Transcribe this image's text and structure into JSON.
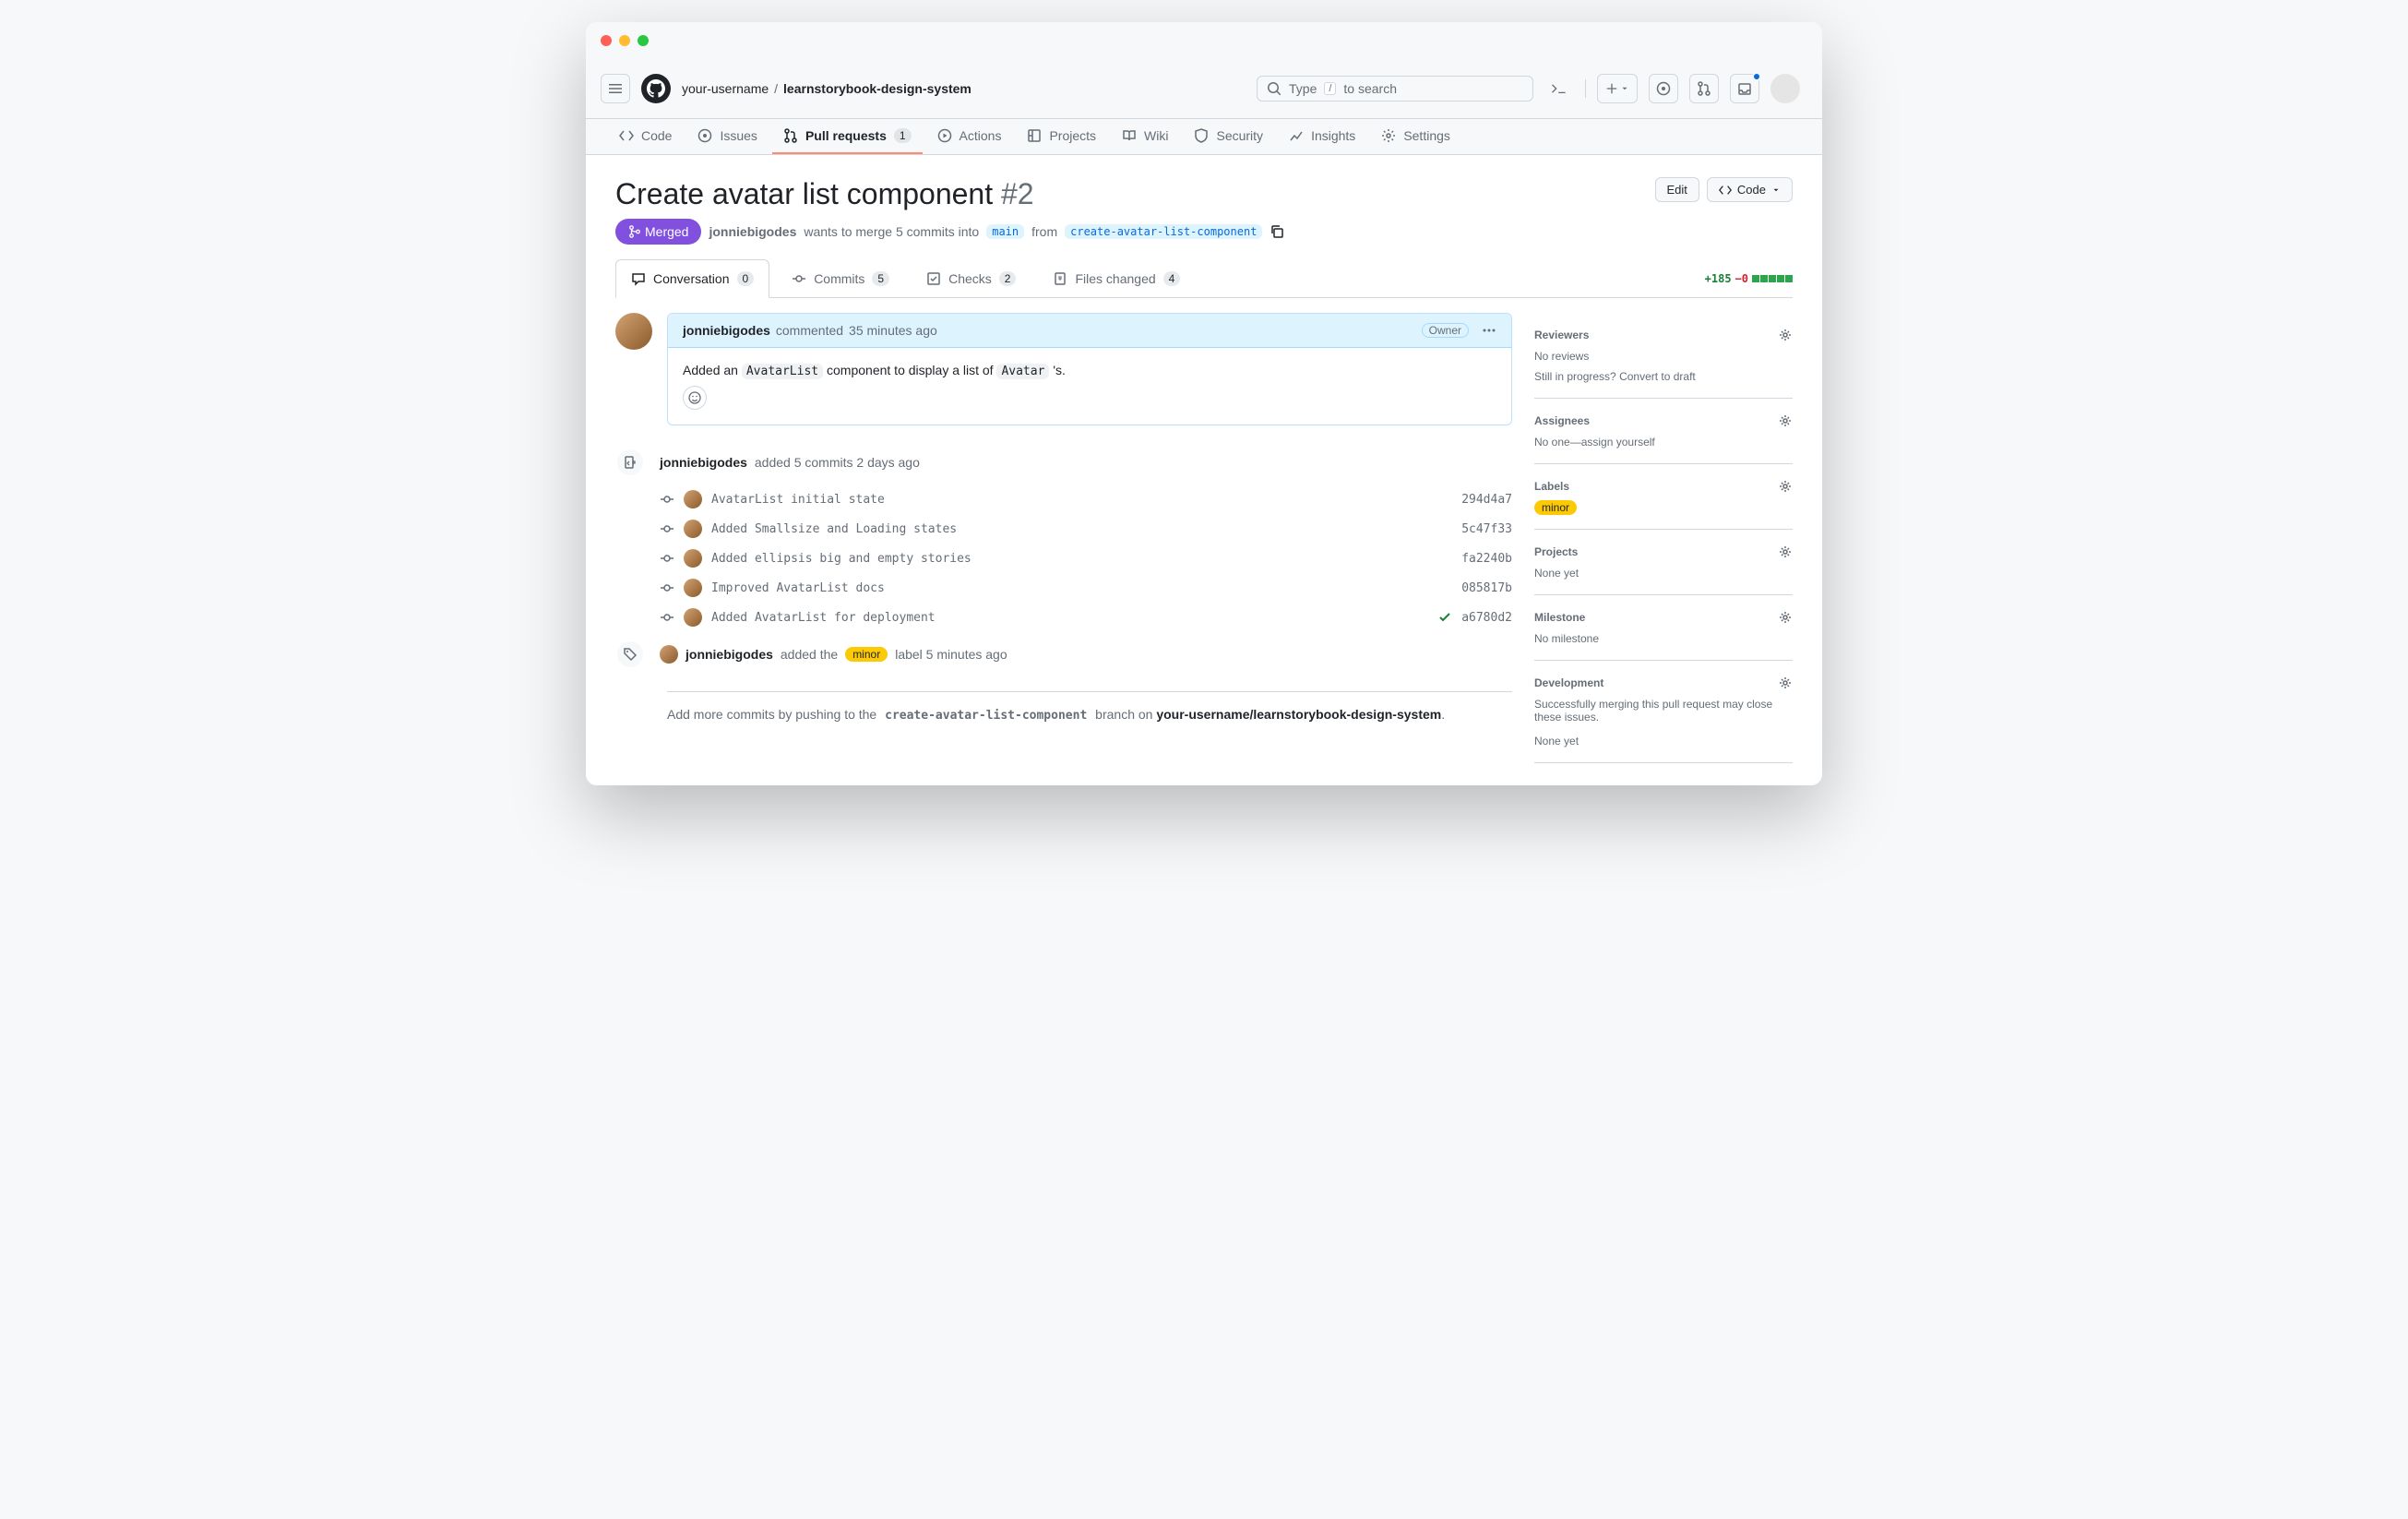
{
  "breadcrumb": {
    "owner": "your-username",
    "repo": "learnstorybook-design-system"
  },
  "search": {
    "prefix": "Type",
    "key": "/",
    "suffix": "to search"
  },
  "repo_tabs": {
    "code": "Code",
    "issues": "Issues",
    "pull_requests": "Pull requests",
    "pull_requests_count": "1",
    "actions": "Actions",
    "projects": "Projects",
    "wiki": "Wiki",
    "security": "Security",
    "insights": "Insights",
    "settings": "Settings"
  },
  "pr": {
    "title": "Create avatar list component",
    "number": "#2",
    "state": "Merged",
    "author": "jonniebigodes",
    "merge_text_1": "wants to merge 5 commits into",
    "base": "main",
    "merge_text_2": "from",
    "head": "create-avatar-list-component",
    "edit_btn": "Edit",
    "code_btn": "Code"
  },
  "pr_tabs": {
    "conversation": "Conversation",
    "conversation_count": "0",
    "commits": "Commits",
    "commits_count": "5",
    "checks": "Checks",
    "checks_count": "2",
    "files": "Files changed",
    "files_count": "4"
  },
  "diffstat": {
    "additions": "+185",
    "deletions": "−0"
  },
  "comment": {
    "author": "jonniebigodes",
    "verb": "commented",
    "when": "35 minutes ago",
    "badge": "Owner",
    "body_1": "Added an",
    "body_code_1": "AvatarList",
    "body_2": "component to display a list of",
    "body_code_2": "Avatar",
    "body_3": "'s."
  },
  "push_event": {
    "author": "jonniebigodes",
    "text": "added 5 commits 2 days ago"
  },
  "commits": [
    {
      "msg": "AvatarList initial state",
      "sha": "294d4a7",
      "ok": false
    },
    {
      "msg": "Added Smallsize and Loading states",
      "sha": "5c47f33",
      "ok": false
    },
    {
      "msg": "Added ellipsis big and empty stories",
      "sha": "fa2240b",
      "ok": false
    },
    {
      "msg": "Improved AvatarList docs",
      "sha": "085817b",
      "ok": false
    },
    {
      "msg": "Added AvatarList for deployment",
      "sha": "a6780d2",
      "ok": true
    }
  ],
  "label_event": {
    "author": "jonniebigodes",
    "pre": "added the",
    "label": "minor",
    "post": "label 5 minutes ago"
  },
  "push_help": {
    "pre": "Add more commits by pushing to the",
    "branch": "create-avatar-list-component",
    "mid": "branch on",
    "repo": "your-username/learnstorybook-design-system",
    "end": "."
  },
  "sidebar": {
    "reviewers": {
      "title": "Reviewers",
      "line1": "No reviews",
      "line2_pre": "Still in progress?",
      "line2_link": "Convert to draft"
    },
    "assignees": {
      "title": "Assignees",
      "line_pre": "No one—",
      "line_link": "assign yourself"
    },
    "labels": {
      "title": "Labels",
      "label": "minor"
    },
    "projects": {
      "title": "Projects",
      "line": "None yet"
    },
    "milestone": {
      "title": "Milestone",
      "line": "No milestone"
    },
    "development": {
      "title": "Development",
      "line1": "Successfully merging this pull request may close these issues.",
      "line2": "None yet"
    }
  }
}
